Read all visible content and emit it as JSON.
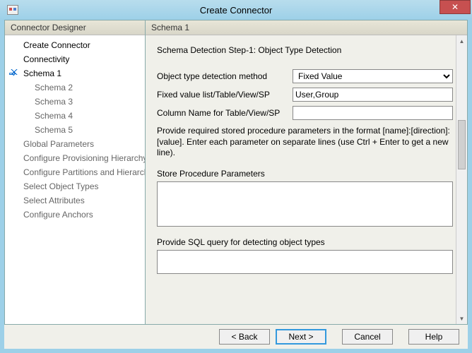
{
  "window": {
    "title": "Create Connector"
  },
  "sidebar": {
    "header": "Connector Designer",
    "items": [
      {
        "label": "Create Connector",
        "primary": true
      },
      {
        "label": "Connectivity",
        "primary": true
      },
      {
        "label": "Schema 1",
        "primary": true,
        "selected": true
      },
      {
        "label": "Schema 2",
        "sub": true
      },
      {
        "label": "Schema 3",
        "sub": true
      },
      {
        "label": "Schema 4",
        "sub": true
      },
      {
        "label": "Schema 5",
        "sub": true
      },
      {
        "label": "Global Parameters"
      },
      {
        "label": "Configure Provisioning Hierarchy"
      },
      {
        "label": "Configure Partitions and Hierarchies"
      },
      {
        "label": "Select Object Types"
      },
      {
        "label": "Select Attributes"
      },
      {
        "label": "Configure Anchors"
      }
    ]
  },
  "panel": {
    "header": "Schema 1",
    "step_title": "Schema Detection Step-1: Object Type Detection",
    "f_method_label": "Object type detection method",
    "f_method_value": "Fixed Value",
    "f_fixed_label": "Fixed value list/Table/View/SP",
    "f_fixed_value": "User,Group",
    "f_column_label": "Column Name for Table/View/SP",
    "f_column_value": "",
    "help_text": "Provide required stored procedure parameters in the format [name]:[direction]:[value]. Enter each parameter on separate lines (use Ctrl + Enter to get a new line).",
    "sp_params_label": "Store Procedure Parameters",
    "sp_params_value": "",
    "sql_label": "Provide SQL query for detecting object types",
    "sql_value": ""
  },
  "buttons": {
    "back": "<  Back",
    "next": "Next  >",
    "cancel": "Cancel",
    "help": "Help"
  }
}
